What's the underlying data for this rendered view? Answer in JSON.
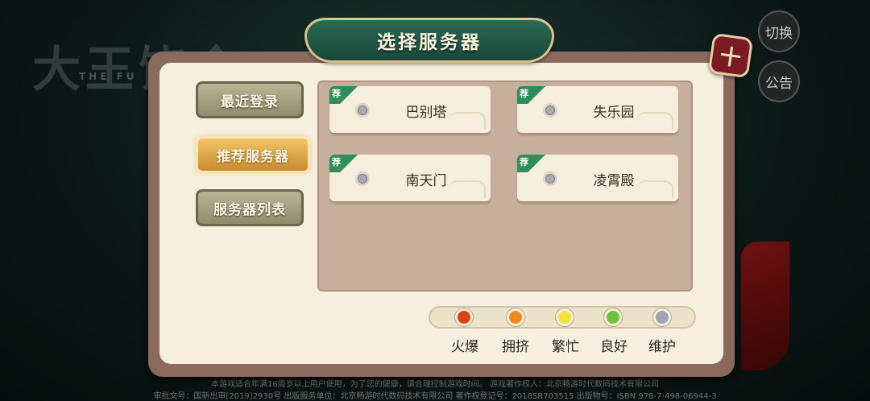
{
  "background": {
    "logo_text": "大王饶命",
    "logo_subtitle": "THE FU",
    "footer_line1": "本游戏适合年满16周岁以上用户使用，为了您的健康，请合理控制游戏时间。 游戏著作权人：北京畅游时代数码技术有限公司",
    "footer_line2": "审批文号：国新出审[2019]2930号  出版服务单位：北京畅游时代数码技术有限公司  著作权登记号：2018SR703515  出版物号：ISBN 978-7-498-06944-3"
  },
  "side_buttons": {
    "switch_label": "切换",
    "notice_label": "公告"
  },
  "dialog": {
    "title": "选择服务器",
    "close_glyph": "十",
    "tabs": [
      {
        "label": "最近登录"
      },
      {
        "label": "推荐服务器"
      },
      {
        "label": "服务器列表"
      }
    ],
    "active_tab": "推荐服务器",
    "servers": [
      {
        "badge": "荐",
        "name": "巴别塔",
        "status": "维护"
      },
      {
        "badge": "荐",
        "name": "失乐园",
        "status": "维护"
      },
      {
        "badge": "荐",
        "name": "南天门",
        "status": "维护"
      },
      {
        "badge": "荐",
        "name": "凌霄殿",
        "status": "维护"
      }
    ],
    "legend": [
      {
        "label": "火爆",
        "color": "#d8431c"
      },
      {
        "label": "拥挤",
        "color": "#f08a1e"
      },
      {
        "label": "繁忙",
        "color": "#f3e23a"
      },
      {
        "label": "良好",
        "color": "#6cc23a"
      },
      {
        "label": "维护",
        "color": "#a3a3ad"
      }
    ]
  }
}
